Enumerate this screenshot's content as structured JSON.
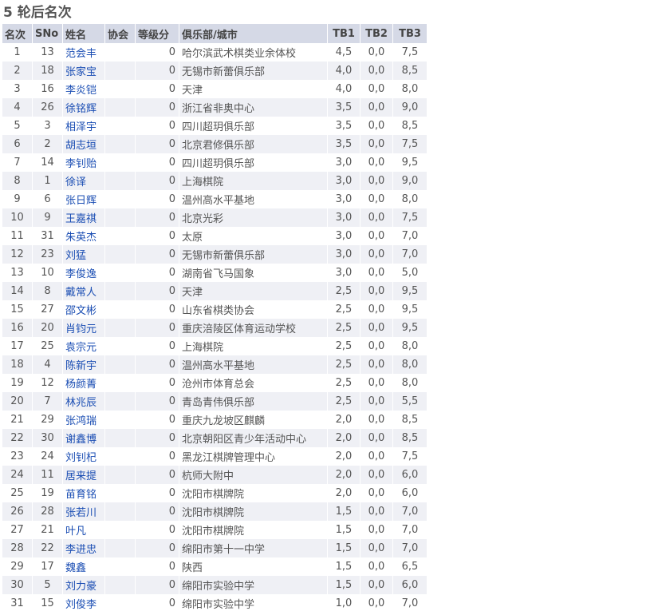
{
  "page_title": "5 轮后名次",
  "columns": [
    "名次",
    "SNo",
    "姓名",
    "协会",
    "等级分",
    "俱乐部/城市",
    "TB1",
    "TB2",
    "TB3"
  ],
  "rows": [
    {
      "rank": "1",
      "sno": "13",
      "name": "范会丰",
      "fed": "",
      "rating": "0",
      "club": "哈尔滨武术棋类业余体校",
      "tb1": "4,5",
      "tb2": "0,0",
      "tb3": "7,5"
    },
    {
      "rank": "2",
      "sno": "18",
      "name": "张家宝",
      "fed": "",
      "rating": "0",
      "club": "无锡市新蕾俱乐部",
      "tb1": "4,0",
      "tb2": "0,0",
      "tb3": "8,5"
    },
    {
      "rank": "3",
      "sno": "16",
      "name": "李炎铠",
      "fed": "",
      "rating": "0",
      "club": "天津",
      "tb1": "4,0",
      "tb2": "0,0",
      "tb3": "8,0"
    },
    {
      "rank": "4",
      "sno": "26",
      "name": "徐铭辉",
      "fed": "",
      "rating": "0",
      "club": "浙江省非奥中心",
      "tb1": "3,5",
      "tb2": "0,0",
      "tb3": "9,0"
    },
    {
      "rank": "5",
      "sno": "3",
      "name": "相泽宇",
      "fed": "",
      "rating": "0",
      "club": "四川超玥俱乐部",
      "tb1": "3,5",
      "tb2": "0,0",
      "tb3": "8,5"
    },
    {
      "rank": "6",
      "sno": "2",
      "name": "胡志垣",
      "fed": "",
      "rating": "0",
      "club": "北京君修俱乐部",
      "tb1": "3,5",
      "tb2": "0,0",
      "tb3": "7,5"
    },
    {
      "rank": "7",
      "sno": "14",
      "name": "李钊贻",
      "fed": "",
      "rating": "0",
      "club": "四川超玥俱乐部",
      "tb1": "3,0",
      "tb2": "0,0",
      "tb3": "9,5"
    },
    {
      "rank": "8",
      "sno": "1",
      "name": "徐译",
      "fed": "",
      "rating": "0",
      "club": "上海棋院",
      "tb1": "3,0",
      "tb2": "0,0",
      "tb3": "9,0"
    },
    {
      "rank": "9",
      "sno": "6",
      "name": "张日辉",
      "fed": "",
      "rating": "0",
      "club": "温州高水平基地",
      "tb1": "3,0",
      "tb2": "0,0",
      "tb3": "8,0"
    },
    {
      "rank": "10",
      "sno": "9",
      "name": "王嘉祺",
      "fed": "",
      "rating": "0",
      "club": "北京光彩",
      "tb1": "3,0",
      "tb2": "0,0",
      "tb3": "7,5"
    },
    {
      "rank": "11",
      "sno": "31",
      "name": "朱英杰",
      "fed": "",
      "rating": "0",
      "club": "太原",
      "tb1": "3,0",
      "tb2": "0,0",
      "tb3": "7,0"
    },
    {
      "rank": "12",
      "sno": "23",
      "name": "刘猛",
      "fed": "",
      "rating": "0",
      "club": "无锡市新蕾俱乐部",
      "tb1": "3,0",
      "tb2": "0,0",
      "tb3": "7,0"
    },
    {
      "rank": "13",
      "sno": "10",
      "name": "李俊逸",
      "fed": "",
      "rating": "0",
      "club": "湖南省飞马国象",
      "tb1": "3,0",
      "tb2": "0,0",
      "tb3": "5,0"
    },
    {
      "rank": "14",
      "sno": "8",
      "name": "戴常人",
      "fed": "",
      "rating": "0",
      "club": "天津",
      "tb1": "2,5",
      "tb2": "0,0",
      "tb3": "9,5"
    },
    {
      "rank": "15",
      "sno": "27",
      "name": "邵文彬",
      "fed": "",
      "rating": "0",
      "club": "山东省棋类协会",
      "tb1": "2,5",
      "tb2": "0,0",
      "tb3": "9,5"
    },
    {
      "rank": "16",
      "sno": "20",
      "name": "肖钧元",
      "fed": "",
      "rating": "0",
      "club": "重庆涪陵区体育运动学校",
      "tb1": "2,5",
      "tb2": "0,0",
      "tb3": "9,5"
    },
    {
      "rank": "17",
      "sno": "25",
      "name": "袁宗元",
      "fed": "",
      "rating": "0",
      "club": "上海棋院",
      "tb1": "2,5",
      "tb2": "0,0",
      "tb3": "8,0"
    },
    {
      "rank": "18",
      "sno": "4",
      "name": "陈新宇",
      "fed": "",
      "rating": "0",
      "club": "温州高水平基地",
      "tb1": "2,5",
      "tb2": "0,0",
      "tb3": "8,0"
    },
    {
      "rank": "19",
      "sno": "12",
      "name": "杨颜菁",
      "fed": "",
      "rating": "0",
      "club": "沧州市体育总会",
      "tb1": "2,5",
      "tb2": "0,0",
      "tb3": "8,0"
    },
    {
      "rank": "20",
      "sno": "7",
      "name": "林兆辰",
      "fed": "",
      "rating": "0",
      "club": "青岛青伟俱乐部",
      "tb1": "2,5",
      "tb2": "0,0",
      "tb3": "5,5"
    },
    {
      "rank": "21",
      "sno": "29",
      "name": "张鸿瑞",
      "fed": "",
      "rating": "0",
      "club": "重庆九龙坡区麒麟",
      "tb1": "2,0",
      "tb2": "0,0",
      "tb3": "8,5"
    },
    {
      "rank": "22",
      "sno": "30",
      "name": "谢鑫博",
      "fed": "",
      "rating": "0",
      "club": "北京朝阳区青少年活动中心",
      "tb1": "2,0",
      "tb2": "0,0",
      "tb3": "8,5"
    },
    {
      "rank": "23",
      "sno": "24",
      "name": "刘钊杞",
      "fed": "",
      "rating": "0",
      "club": "黑龙江棋牌管理中心",
      "tb1": "2,0",
      "tb2": "0,0",
      "tb3": "7,5"
    },
    {
      "rank": "24",
      "sno": "11",
      "name": "居来提",
      "fed": "",
      "rating": "0",
      "club": "杭师大附中",
      "tb1": "2,0",
      "tb2": "0,0",
      "tb3": "6,0"
    },
    {
      "rank": "25",
      "sno": "19",
      "name": "苗育铭",
      "fed": "",
      "rating": "0",
      "club": "沈阳市棋牌院",
      "tb1": "2,0",
      "tb2": "0,0",
      "tb3": "6,0"
    },
    {
      "rank": "26",
      "sno": "28",
      "name": "张若川",
      "fed": "",
      "rating": "0",
      "club": "沈阳市棋牌院",
      "tb1": "1,5",
      "tb2": "0,0",
      "tb3": "7,0"
    },
    {
      "rank": "27",
      "sno": "21",
      "name": "叶凡",
      "fed": "",
      "rating": "0",
      "club": "沈阳市棋牌院",
      "tb1": "1,5",
      "tb2": "0,0",
      "tb3": "7,0"
    },
    {
      "rank": "28",
      "sno": "22",
      "name": "李进忠",
      "fed": "",
      "rating": "0",
      "club": "绵阳市第十一中学",
      "tb1": "1,5",
      "tb2": "0,0",
      "tb3": "7,0"
    },
    {
      "rank": "29",
      "sno": "17",
      "name": "魏鑫",
      "fed": "",
      "rating": "0",
      "club": "陕西",
      "tb1": "1,5",
      "tb2": "0,0",
      "tb3": "6,5"
    },
    {
      "rank": "30",
      "sno": "5",
      "name": "刘力豪",
      "fed": "",
      "rating": "0",
      "club": "绵阳市实验中学",
      "tb1": "1,5",
      "tb2": "0,0",
      "tb3": "6,0"
    },
    {
      "rank": "31",
      "sno": "15",
      "name": "刘俊李",
      "fed": "",
      "rating": "0",
      "club": "绵阳市实验中学",
      "tb1": "1,0",
      "tb2": "0,0",
      "tb3": "7,0"
    }
  ]
}
